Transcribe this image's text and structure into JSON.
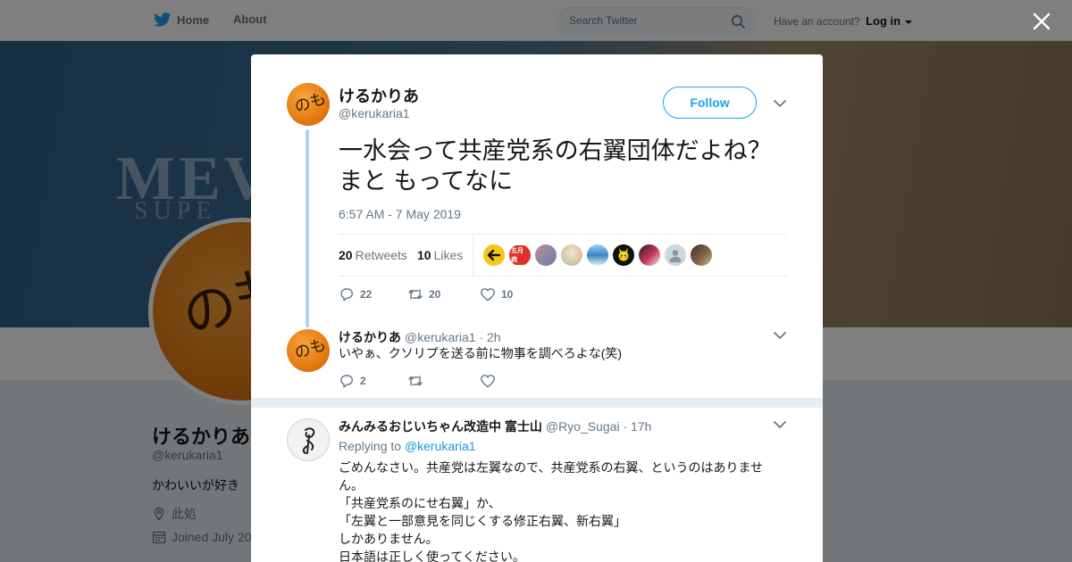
{
  "topbar": {
    "home_label": "Home",
    "about_label": "About",
    "search_placeholder": "Search Twitter",
    "account_prompt": "Have an account?",
    "login_label": "Log in"
  },
  "banner": {
    "text": "MEV",
    "subtext": "SUPE"
  },
  "profile": {
    "name": "けるかりあ",
    "handle": "@kerukaria1",
    "bio": "かわいいが好き",
    "location": "此処",
    "joined": "Joined July 20"
  },
  "tweet": {
    "author_name": "けるかりあ",
    "author_handle": "@kerukaria1",
    "follow_label": "Follow",
    "text_lines": [
      "一水会って共産党系の右翼団体だよね？",
      "まと もってなに"
    ],
    "timestamp": "6:57 AM - 7 May 2019",
    "retweets_count": "20",
    "retweets_label": "Retweets",
    "likes_count": "10",
    "likes_label": "Likes",
    "actions": {
      "replies": "22",
      "retweets": "20",
      "likes": "10"
    },
    "liker_tags": [
      "五月病"
    ]
  },
  "replies": [
    {
      "author_name": "けるかりあ",
      "author_handle": "@kerukaria1",
      "time": "· 2h",
      "text": "いやぁ、クソリプを送る前に物事を調べろよな(笑)",
      "actions": {
        "replies": "2",
        "retweets": "",
        "likes": ""
      }
    },
    {
      "author_name": "みんみるおじいちゃん改造中 富士山",
      "author_handle": "@Ryo_Sugai",
      "time": "· 17h",
      "replying_prefix": "Replying to",
      "replying_to": "@kerukaria1",
      "text_lines": [
        "ごめんなさい。共産党は左翼なので、共産党系の右翼、というのはありませ",
        "ん。",
        "「共産党系のにせ右翼」か、",
        "「左翼と一部意見を同じくする修正右翼、新右翼」",
        "しかありません。",
        "日本語は正しく使ってください。"
      ]
    }
  ],
  "colors": {
    "accent": "#1da1f2",
    "thread_line": "#a7d5f2",
    "secondary_text": "#657786"
  }
}
